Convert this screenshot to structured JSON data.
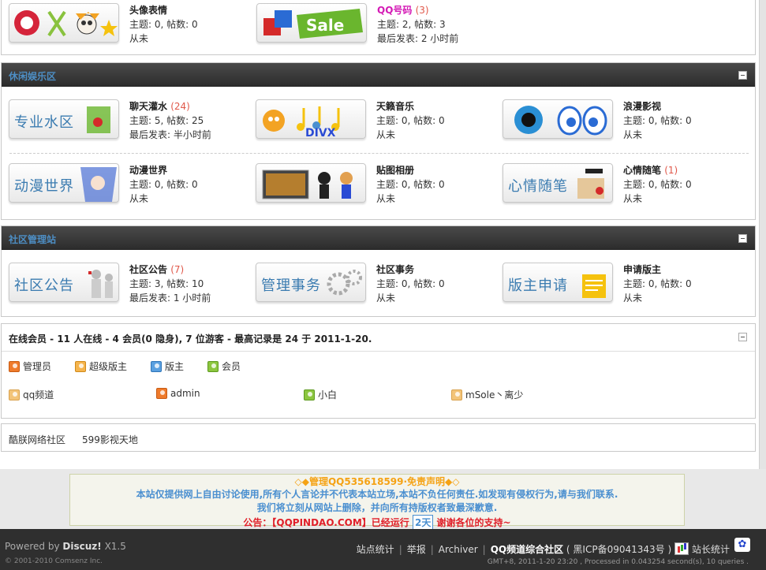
{
  "top_forums": [
    {
      "name": "头像表情",
      "count": "",
      "stats": "主题: 0, 帖数: 0",
      "last": "从未",
      "icon": "avatar-emoji-icon"
    },
    {
      "name": "QQ号码",
      "count": "(3)",
      "stats": "主题: 2, 帖数: 3",
      "last": "最后发表: 2 小时前",
      "icon": "sale-icon",
      "banner": "Sale"
    }
  ],
  "leisure": {
    "title": "休闲娱乐区",
    "forums": [
      {
        "name": "聊天灌水",
        "count": "(24)",
        "stats": "主题: 5, 帖数: 25",
        "last": "最后发表: 半小时前",
        "banner": "专业水区"
      },
      {
        "name": "天籁音乐",
        "count": "",
        "stats": "主题: 0, 帖数: 0",
        "last": "从未",
        "banner": "DIVX"
      },
      {
        "name": "浪漫影视",
        "count": "",
        "stats": "主题: 0, 帖数: 0",
        "last": "从未",
        "banner": ""
      },
      {
        "name": "动漫世界",
        "count": "",
        "stats": "主题: 0, 帖数: 0",
        "last": "从未",
        "banner": "动漫世界"
      },
      {
        "name": "贴图相册",
        "count": "",
        "stats": "主题: 0, 帖数: 0",
        "last": "从未",
        "banner": ""
      },
      {
        "name": "心情随笔",
        "count": "(1)",
        "stats": "主题: 0, 帖数: 0",
        "last": "从未",
        "banner": "心情随笔"
      }
    ]
  },
  "admin_area": {
    "title": "社区管理站",
    "forums": [
      {
        "name": "社区公告",
        "count": "(7)",
        "stats": "主题: 3, 帖数: 10",
        "last": "最后发表: 1 小时前",
        "banner": "社区公告"
      },
      {
        "name": "社区事务",
        "count": "",
        "stats": "主题: 0, 帖数: 0",
        "last": "从未",
        "banner": "管理事务"
      },
      {
        "name": "申请版主",
        "count": "",
        "stats": "主题: 0, 帖数: 0",
        "last": "从未",
        "banner": "版主申请"
      }
    ]
  },
  "online": {
    "title": "在线会员 - 11 人在线 - 4 会员(0 隐身), 7 位游客 - 最高记录是 24 于 2011-1-20.",
    "legend": [
      "管理员",
      "超级版主",
      "版主",
      "会员"
    ],
    "users": [
      "qq频道",
      "admin",
      "小白",
      "mSole丶离少"
    ]
  },
  "links": [
    "酷朕网络社区",
    "599影视天地"
  ],
  "notice": {
    "line1": "◇◆管理QQ535618599·免责声明◆◇",
    "line2": "本站仅提供网上自由讨论使用,所有个人言论并不代表本站立场,本站不负任何责任.如发现有侵权行为,请与我们联系.",
    "line3": "我们将立刻从网站上删除，并向所有持版权者致最深歉意.",
    "line4_a": "公告：【QQPINDAO.COM】已经运行",
    "days": "2天",
    "line4_b": "谢谢各位的支持~"
  },
  "footer": {
    "powered_prefix": "Powered by",
    "powered_name": "Discuz!",
    "version": "X1.5",
    "copyright": "© 2001-2010 Comsenz Inc.",
    "link_stats": "站点统计",
    "link_report": "举报",
    "link_archiver": "Archiver",
    "site_name": "QQ频道综合社区",
    "icp": "( 黑ICP备09041343号 )",
    "webmaster_stats": "站长统计",
    "gmt": "GMT+8, 2011-1-20 23:20 , Processed in 0.043254 second(s), 10 queries ."
  },
  "colors": {
    "accent": "#4d8ec4",
    "count": "#e0584a",
    "header_bg": "#2c2c2c"
  }
}
